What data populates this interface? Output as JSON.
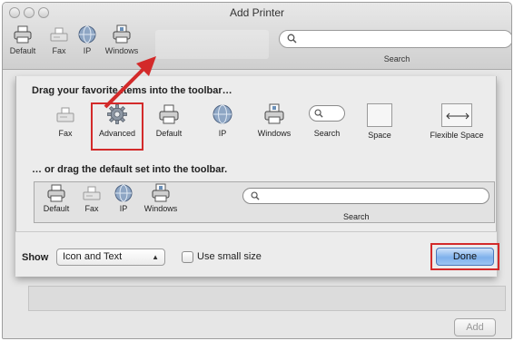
{
  "window": {
    "title": "Add Printer",
    "toolbar": [
      {
        "label": "Default",
        "icon": "printer-icon"
      },
      {
        "label": "Fax",
        "icon": "fax-icon"
      },
      {
        "label": "IP",
        "icon": "globe-icon"
      },
      {
        "label": "Windows",
        "icon": "windows-printer-icon"
      }
    ],
    "search_label": "Search",
    "add_label": "Add"
  },
  "sheet": {
    "heading_top": "Drag your favorite items into the toolbar…",
    "heading_bottom": "… or drag the default set into the toolbar.",
    "palette": [
      {
        "label": "Fax",
        "icon": "fax-icon"
      },
      {
        "label": "Advanced",
        "icon": "gear-icon"
      },
      {
        "label": "Default",
        "icon": "printer-icon"
      },
      {
        "label": "IP",
        "icon": "globe-icon"
      },
      {
        "label": "Windows",
        "icon": "windows-printer-icon"
      },
      {
        "label": "Search",
        "icon": "search-icon"
      },
      {
        "label": "Space",
        "icon": "space-icon"
      },
      {
        "label": "Flexible Space",
        "icon": "flexible-space-icon"
      }
    ],
    "default_set": [
      {
        "label": "Default",
        "icon": "printer-icon"
      },
      {
        "label": "Fax",
        "icon": "fax-icon"
      },
      {
        "label": "IP",
        "icon": "globe-icon"
      },
      {
        "label": "Windows",
        "icon": "windows-printer-icon"
      }
    ],
    "default_set_search_label": "Search",
    "show_label": "Show",
    "show_value": "Icon and Text",
    "small_size_label": "Use small size",
    "done_label": "Done"
  },
  "colors": {
    "highlight": "#d32a2a",
    "done_button": "#7fb1ec"
  }
}
